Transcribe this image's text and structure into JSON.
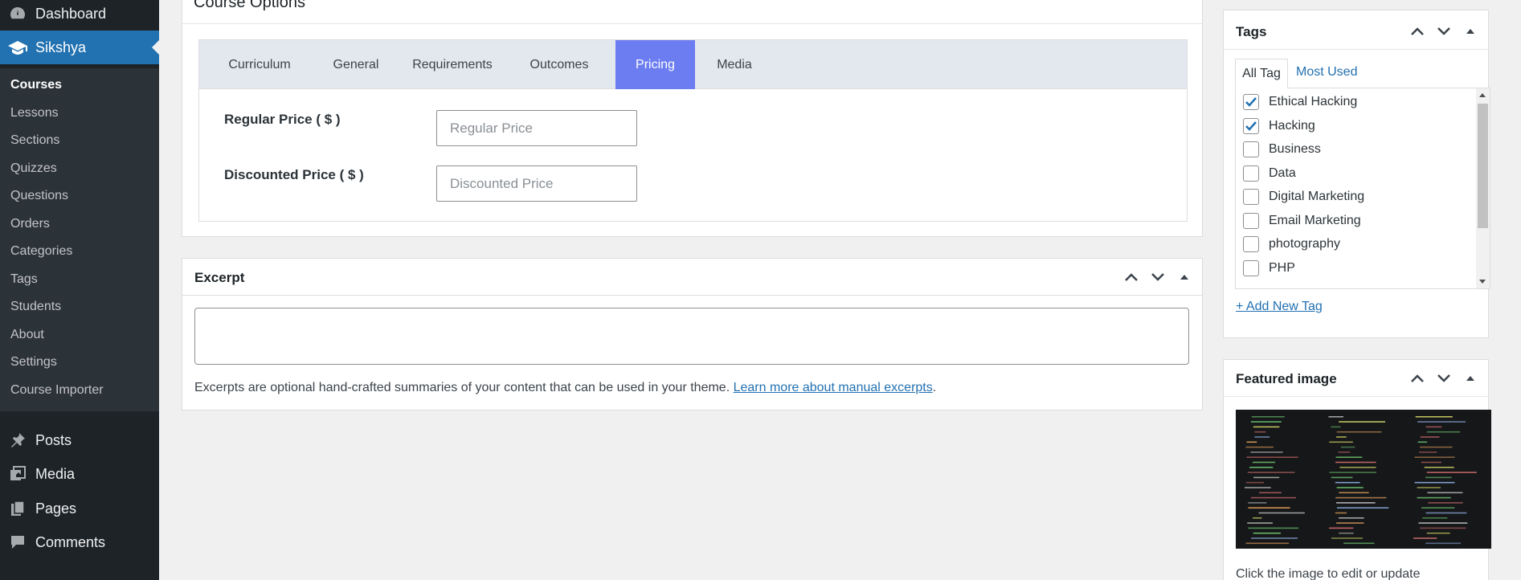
{
  "sidebar": {
    "top_items": [
      {
        "label": "Dashboard",
        "icon": "dashboard-icon"
      },
      {
        "label": "Sikshya",
        "icon": "graduation-cap-icon"
      }
    ],
    "submenu": [
      "Courses",
      "Lessons",
      "Sections",
      "Quizzes",
      "Questions",
      "Orders",
      "Categories",
      "Tags",
      "Students",
      "About",
      "Settings",
      "Course Importer"
    ],
    "bottom_items": [
      {
        "label": "Posts",
        "icon": "pushpin-icon"
      },
      {
        "label": "Media",
        "icon": "media-icon"
      },
      {
        "label": "Pages",
        "icon": "pages-icon"
      },
      {
        "label": "Comments",
        "icon": "comment-icon"
      }
    ]
  },
  "course_options": {
    "title": "Course Options",
    "tabs": [
      "Curriculum",
      "General",
      "Requirements",
      "Outcomes",
      "Pricing",
      "Media"
    ],
    "active_tab": "Pricing",
    "regular_price_label": "Regular Price ( $ )",
    "regular_price_placeholder": "Regular Price",
    "discounted_price_label": "Discounted Price ( $ )",
    "discounted_price_placeholder": "Discounted Price"
  },
  "excerpt": {
    "title": "Excerpt",
    "help_text": "Excerpts are optional hand-crafted summaries of your content that can be used in your theme. ",
    "help_link": "Learn more about manual excerpts",
    "help_period": "."
  },
  "tags": {
    "title": "Tags",
    "tab_all": "All Tag",
    "tab_most_used": "Most Used",
    "items": [
      {
        "label": "Ethical Hacking",
        "checked": true
      },
      {
        "label": "Hacking",
        "checked": true
      },
      {
        "label": "Business",
        "checked": false
      },
      {
        "label": "Data",
        "checked": false
      },
      {
        "label": "Digital Marketing",
        "checked": false
      },
      {
        "label": "Email Marketing",
        "checked": false
      },
      {
        "label": "photography",
        "checked": false
      },
      {
        "label": "PHP",
        "checked": false
      }
    ],
    "add_new": "+ Add New Tag"
  },
  "featured_image": {
    "title": "Featured image",
    "help_text": "Click the image to edit or update"
  },
  "colors": {
    "sidebar_bg": "#1d2327",
    "accent": "#2271b1",
    "active_tab": "#6b7df0"
  }
}
